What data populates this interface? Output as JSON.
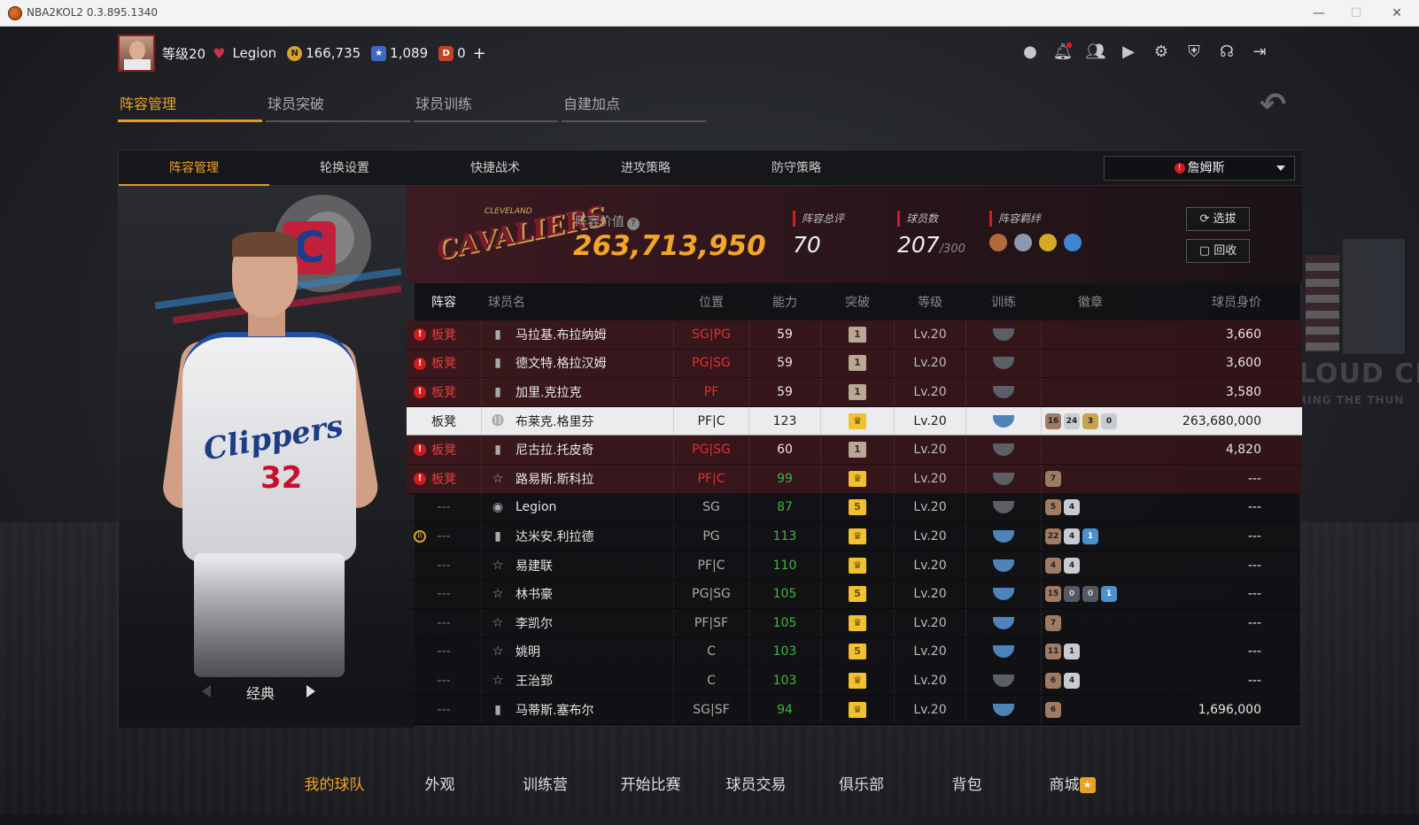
{
  "window": {
    "title": "NBA2KOL2 0.3.895.1340"
  },
  "topbar": {
    "level": "等级20",
    "name": "Legion",
    "coins": "166,735",
    "stars": "1,089",
    "tickets": "0",
    "plus": "+"
  },
  "icons": {
    "profile": "user-icon",
    "bell": "bell-icon",
    "friends": "friends-icon",
    "video": "video-icon",
    "settings": "gear-icon",
    "shield": "shield-icon",
    "support": "headset-icon",
    "exit": "exit-icon"
  },
  "main_tabs": [
    "阵容管理",
    "球员突破",
    "球员训练",
    "自建加点"
  ],
  "sub_tabs": [
    "阵容管理",
    "轮换设置",
    "快捷战术",
    "进攻策略",
    "防守策略"
  ],
  "dropdown": {
    "value": "詹姆斯"
  },
  "team": {
    "logo_text": "CAVALIERS",
    "logo_small": "CLEVELAND",
    "value_label": "阵容价值",
    "value": "263,713,950",
    "rating_label": "阵容总评",
    "rating": "70",
    "count_label": "球员数",
    "count": "207",
    "count_max": "/300",
    "synergy_label": "阵容羁绊",
    "btn_select": "选拔",
    "btn_recycle": "回收"
  },
  "player_card": {
    "classic_label": "经典",
    "jersey_text": "Clippers",
    "jersey_number": "32"
  },
  "table": {
    "headers": [
      "阵容",
      "球员名",
      "位置",
      "能力",
      "突破",
      "等级",
      "训练",
      "徽章",
      "球员身价"
    ],
    "rows": [
      {
        "lineup": "板凳",
        "warn": true,
        "type": "bars",
        "name": "马拉基.布拉纳姆",
        "pos": "SG|PG",
        "pos_red": true,
        "ovr": "59",
        "ovr_green": false,
        "brk": "1",
        "brk_kind": "num",
        "lvl": "Lv.20",
        "train": false,
        "badges": [],
        "price": "3,660",
        "style": "red"
      },
      {
        "lineup": "板凳",
        "warn": true,
        "type": "bars",
        "name": "德文特.格拉汉姆",
        "pos": "PG|SG",
        "pos_red": true,
        "ovr": "59",
        "ovr_green": false,
        "brk": "1",
        "brk_kind": "num",
        "lvl": "Lv.20",
        "train": false,
        "badges": [],
        "price": "3,600",
        "style": "red"
      },
      {
        "lineup": "板凳",
        "warn": true,
        "type": "bars",
        "name": "加里.克拉克",
        "pos": "PF",
        "pos_red": true,
        "ovr": "59",
        "ovr_green": false,
        "brk": "1",
        "brk_kind": "num",
        "lvl": "Lv.20",
        "train": false,
        "badges": [],
        "price": "3,580",
        "style": "red"
      },
      {
        "lineup": "板凳",
        "warn": false,
        "type": "13",
        "name": "布莱克.格里芬",
        "pos": "PF|C",
        "pos_red": false,
        "ovr": "123",
        "ovr_green": false,
        "brk": "♛",
        "brk_kind": "gold",
        "lvl": "Lv.20",
        "train": true,
        "badges": [
          {
            "v": "16",
            "k": "br"
          },
          {
            "v": "24",
            "k": "sv"
          },
          {
            "v": "3",
            "k": "gd"
          },
          {
            "v": "0",
            "k": "sv"
          }
        ],
        "price": "263,680,000",
        "style": "sel"
      },
      {
        "lineup": "板凳",
        "warn": true,
        "type": "bars",
        "name": "尼古拉.托皮奇",
        "pos": "PG|SG",
        "pos_red": true,
        "ovr": "60",
        "ovr_green": false,
        "brk": "1",
        "brk_kind": "num",
        "lvl": "Lv.20",
        "train": false,
        "badges": [],
        "price": "4,820",
        "style": "red"
      },
      {
        "lineup": "板凳",
        "warn": true,
        "type": "star",
        "name": "路易斯.斯科拉",
        "pos": "PF|C",
        "pos_red": true,
        "ovr": "99",
        "ovr_green": true,
        "brk": "♛",
        "brk_kind": "gold",
        "lvl": "Lv.20",
        "train": false,
        "badges": [
          {
            "v": "7",
            "k": "br"
          }
        ],
        "price": "---",
        "style": "red"
      },
      {
        "lineup": "---",
        "warn": false,
        "type": "user",
        "name": "Legion",
        "pos": "SG",
        "pos_red": false,
        "ovr": "87",
        "ovr_green": true,
        "brk": "5",
        "brk_kind": "gold",
        "lvl": "Lv.20",
        "train": false,
        "badges": [
          {
            "v": "5",
            "k": "br"
          },
          {
            "v": "4",
            "k": "sv"
          }
        ],
        "price": "---",
        "style": "norm"
      },
      {
        "lineup": "---",
        "warn": false,
        "r": true,
        "type": "bars",
        "name": "达米安.利拉德",
        "pos": "PG",
        "pos_red": false,
        "ovr": "113",
        "ovr_green": true,
        "brk": "♛",
        "brk_kind": "gold",
        "lvl": "Lv.20",
        "train": true,
        "badges": [
          {
            "v": "22",
            "k": "br"
          },
          {
            "v": "4",
            "k": "sv"
          },
          {
            "v": "1",
            "k": "bl"
          }
        ],
        "price": "---",
        "style": "norm"
      },
      {
        "lineup": "---",
        "warn": false,
        "type": "star",
        "name": "易建联",
        "pos": "PF|C",
        "pos_red": false,
        "ovr": "110",
        "ovr_green": true,
        "brk": "♛",
        "brk_kind": "gold",
        "lvl": "Lv.20",
        "train": true,
        "badges": [
          {
            "v": "4",
            "k": "br"
          },
          {
            "v": "4",
            "k": "sv"
          }
        ],
        "price": "---",
        "style": "norm"
      },
      {
        "lineup": "---",
        "warn": false,
        "type": "star",
        "name": "林书豪",
        "pos": "PG|SG",
        "pos_red": false,
        "ovr": "105",
        "ovr_green": true,
        "brk": "5",
        "brk_kind": "gold",
        "lvl": "Lv.20",
        "train": true,
        "badges": [
          {
            "v": "15",
            "k": "br"
          },
          {
            "v": "0",
            "k": "dk"
          },
          {
            "v": "0",
            "k": "dk"
          },
          {
            "v": "1",
            "k": "bl"
          }
        ],
        "price": "---",
        "style": "norm"
      },
      {
        "lineup": "---",
        "warn": false,
        "type": "star",
        "name": "李凯尔",
        "pos": "PF|SF",
        "pos_red": false,
        "ovr": "105",
        "ovr_green": true,
        "brk": "♛",
        "brk_kind": "gold",
        "lvl": "Lv.20",
        "train": true,
        "badges": [
          {
            "v": "7",
            "k": "br"
          }
        ],
        "price": "---",
        "style": "norm"
      },
      {
        "lineup": "---",
        "warn": false,
        "type": "star",
        "name": "姚明",
        "pos": "C",
        "pos_red": false,
        "ovr": "103",
        "ovr_green": true,
        "brk": "5",
        "brk_kind": "gold",
        "lvl": "Lv.20",
        "train": true,
        "badges": [
          {
            "v": "11",
            "k": "br"
          },
          {
            "v": "1",
            "k": "sv"
          }
        ],
        "price": "---",
        "style": "norm"
      },
      {
        "lineup": "---",
        "warn": false,
        "type": "star",
        "name": "王治郅",
        "pos": "C",
        "pos_red": false,
        "ovr": "103",
        "ovr_green": true,
        "brk": "♛",
        "brk_kind": "gold",
        "lvl": "Lv.20",
        "train": false,
        "badges": [
          {
            "v": "6",
            "k": "br"
          },
          {
            "v": "4",
            "k": "sv"
          }
        ],
        "price": "---",
        "style": "norm"
      },
      {
        "lineup": "---",
        "warn": false,
        "type": "bars",
        "name": "马蒂斯.塞布尔",
        "pos": "SG|SF",
        "pos_red": false,
        "ovr": "94",
        "ovr_green": true,
        "brk": "♛",
        "brk_kind": "gold",
        "lvl": "Lv.20",
        "train": true,
        "badges": [
          {
            "v": "6",
            "k": "br"
          }
        ],
        "price": "1,696,000",
        "style": "norm"
      }
    ]
  },
  "bottom_nav": [
    "我的球队",
    "外观",
    "训练营",
    "开始比赛",
    "球员交易",
    "俱乐部",
    "背包",
    "商城"
  ],
  "background": {
    "banner_text": "LOUD CITY",
    "banner_sub": "RING THE THUN"
  }
}
